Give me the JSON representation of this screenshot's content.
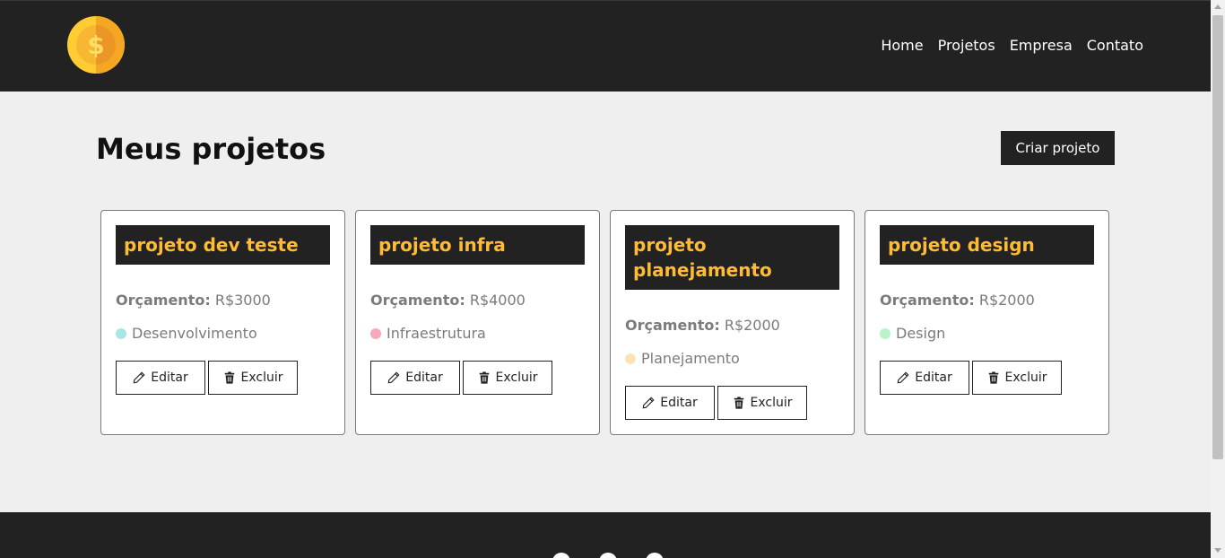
{
  "nav": {
    "logo_icon": "dollar-coin-icon",
    "links": [
      "Home",
      "Projetos",
      "Empresa",
      "Contato"
    ]
  },
  "main": {
    "title": "Meus projetos",
    "create_button": "Criar projeto"
  },
  "projects": [
    {
      "name": "projeto dev teste",
      "budget_label": "Orçamento:",
      "budget_value": "R$3000",
      "category": "Desenvolvimento",
      "category_color": "#a8e6e8",
      "edit_label": "Editar",
      "delete_label": "Excluir"
    },
    {
      "name": "projeto infra",
      "budget_label": "Orçamento:",
      "budget_value": "R$4000",
      "category": "Infraestrutura",
      "category_color": "#f5a9bd",
      "edit_label": "Editar",
      "delete_label": "Excluir"
    },
    {
      "name": "projeto planejamento",
      "budget_label": "Orçamento:",
      "budget_value": "R$2000",
      "category": "Planejamento",
      "category_color": "#fde4b5",
      "edit_label": "Editar",
      "delete_label": "Excluir"
    },
    {
      "name": "projeto design",
      "budget_label": "Orçamento:",
      "budget_value": "R$2000",
      "category": "Design",
      "category_color": "#b9f3c8",
      "edit_label": "Editar",
      "delete_label": "Excluir"
    }
  ],
  "footer": {
    "social_icons": [
      "facebook-icon",
      "instagram-icon",
      "linkedin-icon"
    ]
  },
  "colors": {
    "dark": "#222222",
    "accent": "#ffbb33",
    "background": "#efefef"
  }
}
